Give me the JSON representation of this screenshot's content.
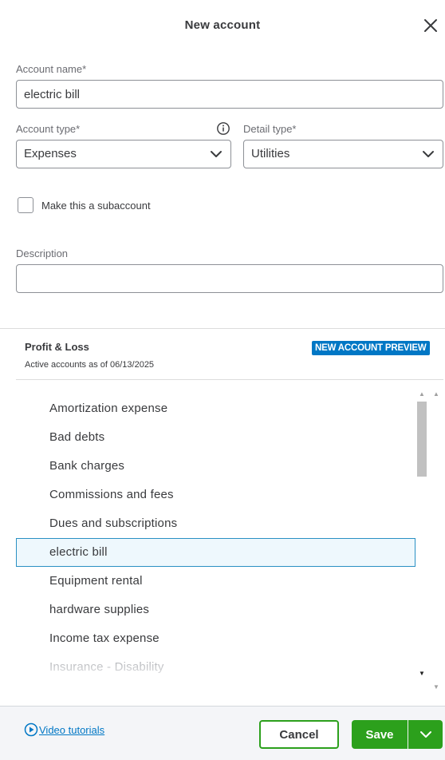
{
  "dialog": {
    "title": "New account",
    "close_icon": "close-icon"
  },
  "form": {
    "account_name": {
      "label": "Account name*",
      "value": "electric bill"
    },
    "account_type": {
      "label": "Account type*",
      "value": "Expenses",
      "info_icon": "info-icon"
    },
    "detail_type": {
      "label": "Detail type*",
      "value": "Utilities"
    },
    "subaccount": {
      "label": "Make this a subaccount",
      "checked": false
    },
    "description": {
      "label": "Description",
      "value": "",
      "placeholder": ""
    }
  },
  "preview": {
    "title": "Profit & Loss",
    "subtitle": "Active accounts as of 06/13/2025",
    "badge": "NEW ACCOUNT PREVIEW",
    "accounts": [
      {
        "name": "Amortization expense"
      },
      {
        "name": "Bad debts"
      },
      {
        "name": "Bank charges"
      },
      {
        "name": "Commissions and fees"
      },
      {
        "name": "Dues and subscriptions"
      },
      {
        "name": "electric bill",
        "highlighted": true
      },
      {
        "name": "Equipment rental"
      },
      {
        "name": "hardware supplies"
      },
      {
        "name": "Income tax expense"
      },
      {
        "name": "Insurance - Disability"
      }
    ]
  },
  "footer": {
    "video_link": "Video tutorials",
    "cancel_label": "Cancel",
    "save_label": "Save"
  },
  "colors": {
    "accent": "#0077c5",
    "primary_button": "#2ca01c",
    "highlight_row": "#eef8fd"
  }
}
